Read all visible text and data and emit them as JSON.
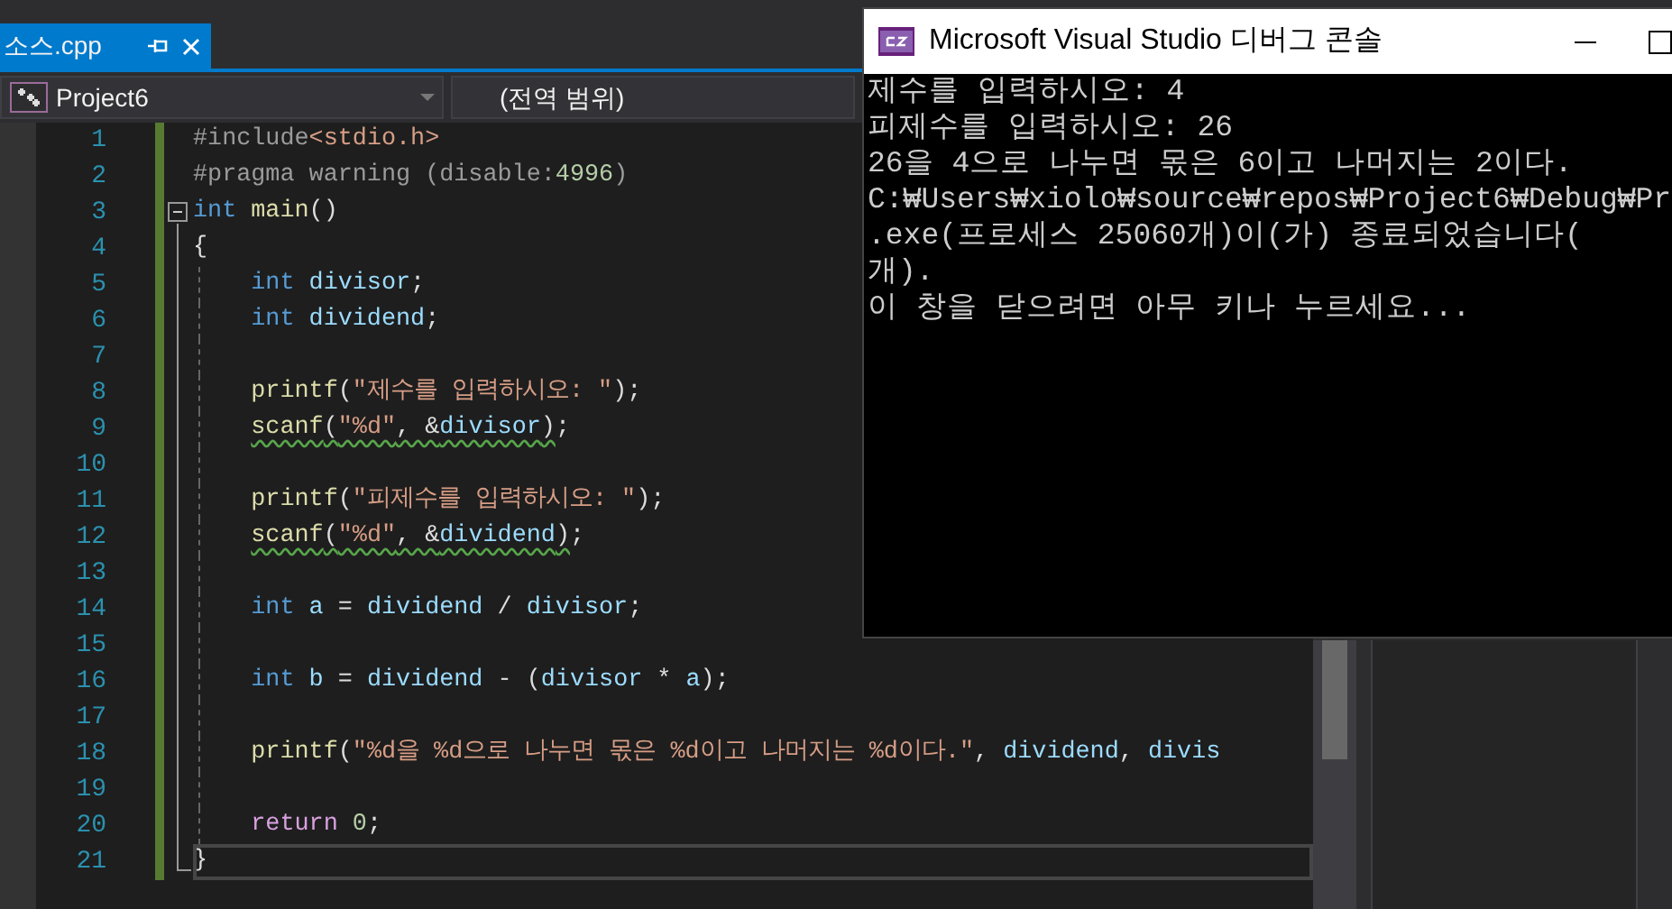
{
  "editor_tab": {
    "title": "소스.cpp",
    "selected": true
  },
  "navigation_bar": {
    "project": "Project6",
    "scope": "(전역 범위)"
  },
  "code_lines": [
    {
      "number": "1",
      "modified": true,
      "tokens": [
        {
          "text": "#include",
          "kind": "preproc"
        },
        {
          "text": "<stdio.h>",
          "kind": "string"
        }
      ]
    },
    {
      "number": "2",
      "modified": true,
      "tokens": [
        {
          "text": "#pragma warning (disable:",
          "kind": "preproc"
        },
        {
          "text": "4996",
          "kind": "number"
        },
        {
          "text": ")",
          "kind": "preproc"
        }
      ]
    },
    {
      "number": "3",
      "modified": true,
      "expanded": true,
      "tokens": [
        {
          "text": "int",
          "kind": "keyword"
        },
        {
          "text": " main",
          "kind": "func"
        },
        {
          "text": "()",
          "kind": "plain"
        }
      ],
      "children": [
        {
          "number": "4",
          "modified": true,
          "tokens": [
            {
              "text": "{",
              "kind": "plain"
            }
          ],
          "children": [
            {
              "number": "5",
              "modified": true,
              "tokens": [
                {
                  "text": "int",
                  "kind": "keyword"
                },
                {
                  "text": " divisor",
                  "kind": "var"
                },
                {
                  "text": ";",
                  "kind": "plain"
                }
              ]
            },
            {
              "number": "6",
              "modified": true,
              "tokens": [
                {
                  "text": "int",
                  "kind": "keyword"
                },
                {
                  "text": " dividend",
                  "kind": "var"
                },
                {
                  "text": ";",
                  "kind": "plain"
                }
              ]
            },
            {
              "number": "7",
              "modified": true
            },
            {
              "number": "8",
              "modified": true,
              "tokens": [
                {
                  "text": "printf",
                  "kind": "func"
                },
                {
                  "text": "(",
                  "kind": "plain"
                },
                {
                  "text": "\"제수를 입력하시오: \"",
                  "kind": "string"
                },
                {
                  "text": ");",
                  "kind": "plain"
                }
              ]
            },
            {
              "number": "9",
              "modified": true,
              "tokens": [
                {
                  "text": "scanf",
                  "kind": "func",
                  "warning": true
                },
                {
                  "text": "(",
                  "kind": "plain",
                  "warning": true
                },
                {
                  "text": "\"%d\"",
                  "kind": "string",
                  "warning": true
                },
                {
                  "text": ", &",
                  "kind": "plain",
                  "warning": true
                },
                {
                  "text": "divisor",
                  "kind": "var",
                  "warning": true
                },
                {
                  "text": ")",
                  "kind": "plain",
                  "warning": true
                },
                {
                  "text": ";",
                  "kind": "plain"
                }
              ]
            },
            {
              "number": "10",
              "modified": true
            },
            {
              "number": "11",
              "modified": true,
              "tokens": [
                {
                  "text": "printf",
                  "kind": "func"
                },
                {
                  "text": "(",
                  "kind": "plain"
                },
                {
                  "text": "\"피제수를 입력하시오: \"",
                  "kind": "string"
                },
                {
                  "text": ");",
                  "kind": "plain"
                }
              ]
            },
            {
              "number": "12",
              "modified": true,
              "tokens": [
                {
                  "text": "scanf",
                  "kind": "func",
                  "warning": true
                },
                {
                  "text": "(",
                  "kind": "plain",
                  "warning": true
                },
                {
                  "text": "\"%d\"",
                  "kind": "string",
                  "warning": true
                },
                {
                  "text": ", &",
                  "kind": "plain",
                  "warning": true
                },
                {
                  "text": "dividend",
                  "kind": "var",
                  "warning": true
                },
                {
                  "text": ")",
                  "kind": "plain",
                  "warning": true
                },
                {
                  "text": ";",
                  "kind": "plain"
                }
              ]
            },
            {
              "number": "13",
              "modified": true
            },
            {
              "number": "14",
              "modified": true,
              "tokens": [
                {
                  "text": "int",
                  "kind": "keyword"
                },
                {
                  "text": " a",
                  "kind": "var"
                },
                {
                  "text": " = ",
                  "kind": "plain"
                },
                {
                  "text": "dividend",
                  "kind": "var"
                },
                {
                  "text": " / ",
                  "kind": "plain"
                },
                {
                  "text": "divisor",
                  "kind": "var"
                },
                {
                  "text": ";",
                  "kind": "plain"
                }
              ]
            },
            {
              "number": "15",
              "modified": true
            },
            {
              "number": "16",
              "modified": true,
              "tokens": [
                {
                  "text": "int",
                  "kind": "keyword"
                },
                {
                  "text": " b",
                  "kind": "var"
                },
                {
                  "text": " = ",
                  "kind": "plain"
                },
                {
                  "text": "dividend",
                  "kind": "var"
                },
                {
                  "text": " - (",
                  "kind": "plain"
                },
                {
                  "text": "divisor",
                  "kind": "var"
                },
                {
                  "text": " * ",
                  "kind": "plain"
                },
                {
                  "text": "a",
                  "kind": "var"
                },
                {
                  "text": ");",
                  "kind": "plain"
                }
              ]
            },
            {
              "number": "17",
              "modified": true
            },
            {
              "number": "18",
              "modified": true,
              "tokens": [
                {
                  "text": "printf",
                  "kind": "func"
                },
                {
                  "text": "(",
                  "kind": "plain"
                },
                {
                  "text": "\"%d을 %d으로 나누면 몫은 %d이고 나머지는 %d이다.\"",
                  "kind": "string"
                },
                {
                  "text": ", ",
                  "kind": "plain"
                },
                {
                  "text": "dividend",
                  "kind": "var"
                },
                {
                  "text": ", ",
                  "kind": "plain"
                },
                {
                  "text": "divis",
                  "kind": "var"
                }
              ]
            },
            {
              "number": "19",
              "modified": true
            },
            {
              "number": "20",
              "modified": true,
              "tokens": [
                {
                  "text": "return",
                  "kind": "control"
                },
                {
                  "text": " 0",
                  "kind": "number"
                },
                {
                  "text": ";",
                  "kind": "plain"
                }
              ]
            }
          ]
        },
        {
          "number": "21",
          "modified": true,
          "current": true,
          "tokens": [
            {
              "text": "}",
              "kind": "plain"
            }
          ]
        }
      ]
    }
  ],
  "console_window": {
    "title": "Microsoft Visual Studio 디버그 콘솔",
    "lines": [
      "제수를 입력하시오: 4",
      "피제수를 입력하시오: 26",
      "26을 4으로 나누면 몫은 6이고 나머지는 2이다.",
      "C:₩Users₩xiolo₩source₩repos₩Project6₩Debug₩Pr",
      ".exe(프로세스 25060개)이(가) 종료되었습니다(",
      "개).",
      "이 창을 닫으려면 아무 키나 누르세요..."
    ]
  }
}
